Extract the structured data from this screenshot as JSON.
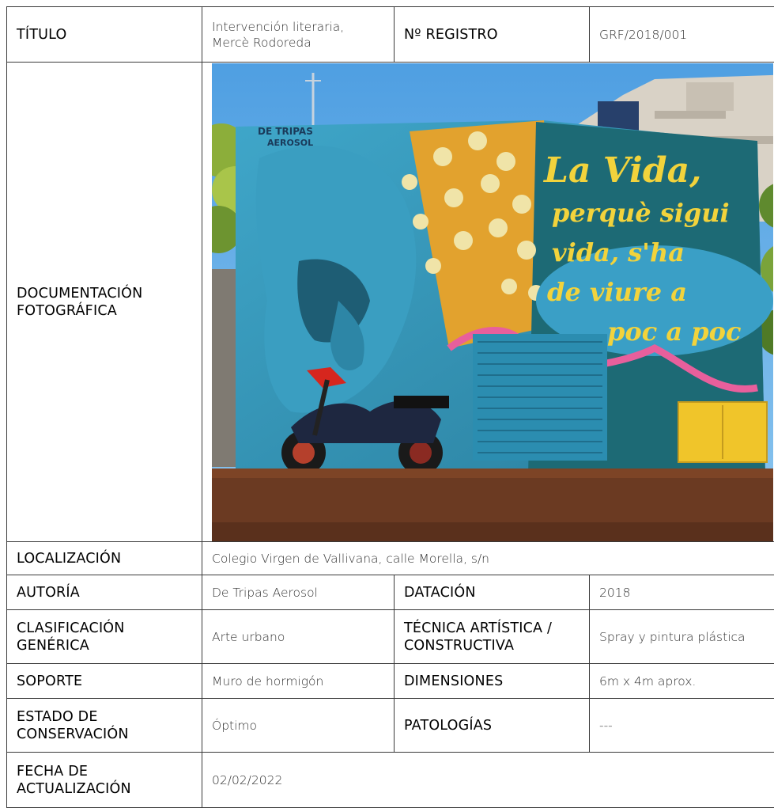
{
  "record": {
    "titulo_label": "TÍTULO",
    "titulo_value": "Intervención literaria, Mercè Rodoreda",
    "registro_label": "Nº REGISTRO",
    "registro_value": "GRF/2018/001",
    "doc_foto_label": "DOCUMENTACIÓN FOTOGRÁFICA",
    "localizacion_label": "LOCALIZACIÓN",
    "localizacion_value": "Colegio Virgen de Vallivana, calle Morella, s/n",
    "autoria_label": "AUTORÍA",
    "autoria_value": "De Tripas Aerosol",
    "datacion_label": "DATACIÓN",
    "datacion_value": "2018",
    "clasificacion_label": "CLASIFICACIÓN GENÉRICA",
    "clasificacion_value": "Arte urbano",
    "tecnica_label": "TÉCNICA ARTÍSTICA / CONSTRUCTIVA",
    "tecnica_value": "Spray y pintura plástica",
    "soporte_label": "SOPORTE",
    "soporte_value": "Muro de hormigón",
    "dimensiones_label": "DIMENSIONES",
    "dimensiones_value": "6m x 4m aprox.",
    "estado_label": "ESTADO DE CONSERVACIÓN",
    "estado_value": "Óptimo",
    "patologias_label": "PATOLOGÍAS",
    "patologias_value": "---",
    "fecha_label": "FECHA DE ACTUALIZACIÓN",
    "fecha_value": "02/02/2022"
  },
  "photo": {
    "mural_text_lines": [
      "La Vida,",
      "perquè sigui",
      "vida, s'ha",
      "de viure a",
      "poc a poc"
    ],
    "tag_line1": "DE TRIPAS",
    "tag_line2": "AEROSOL",
    "colors": {
      "sky": "#5aa6e4",
      "mural_blue": "#2b8fb0",
      "mural_yellow": "#e4a630",
      "mural_teal": "#1f6e78",
      "letters": "#f2d33c",
      "pink": "#e8609a",
      "fence": "#6b3a22"
    }
  }
}
